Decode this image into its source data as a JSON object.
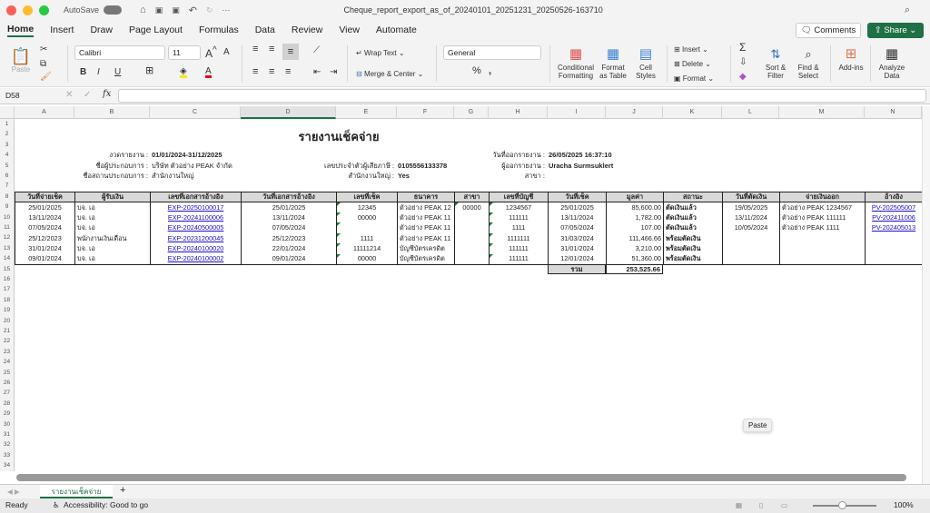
{
  "window": {
    "autosave": "AutoSave",
    "title": "Cheque_report_export_as_of_20240101_20251231_20250526-163710"
  },
  "menu": [
    "Home",
    "Insert",
    "Draw",
    "Page Layout",
    "Formulas",
    "Data",
    "Review",
    "View",
    "Automate"
  ],
  "ribbon": {
    "paste": "Paste",
    "font": "Calibri",
    "size": "11",
    "wrap": "Wrap Text",
    "merge": "Merge & Center",
    "number_format": "General",
    "percent": "%",
    "comma": ",",
    "cond": "Conditional Formatting",
    "fmt_table": "Format as Table",
    "cell_styles": "Cell Styles",
    "insert": "Insert",
    "delete": "Delete",
    "format": "Format",
    "sort": "Sort & Filter",
    "find": "Find & Select",
    "addins": "Add-ins",
    "analyze": "Analyze Data",
    "comments": "Comments",
    "share": "Share",
    "bold": "B",
    "italic": "I",
    "underline": "U",
    "fx": "fx"
  },
  "formula": {
    "cell_ref": "D58",
    "value": ""
  },
  "columns": [
    "A",
    "B",
    "C",
    "D",
    "E",
    "F",
    "G",
    "H",
    "I",
    "J",
    "K",
    "L",
    "M",
    "N"
  ],
  "report": {
    "title": "รายงานเช็คจ่าย",
    "info_left": [
      {
        "label": "งวดรายงาน :",
        "value": "01/01/2024-31/12/2025"
      },
      {
        "label": "ชื่อผู้ประกอบการ :",
        "value": "บริษัท ตัวอย่าง PEAK จำกัด"
      },
      {
        "label": "ชื่อสถานประกอบการ :",
        "value": "สำนักงานใหญ่"
      }
    ],
    "info_mid": [
      {
        "label": "เลขประจำตัวผู้เสียภาษี :",
        "value": "0105556133378"
      },
      {
        "label": "สำนักงานใหญ่ :",
        "value": "Yes"
      }
    ],
    "info_right": [
      {
        "label": "วันที่ออกรายงาน :",
        "value": "26/05/2025 16:37:10"
      },
      {
        "label": "ผู้ออกรายงาน :",
        "value": "Uracha Surmsuklert"
      },
      {
        "label": "สาขา :",
        "value": ""
      }
    ],
    "headers": [
      "วันที่จ่ายเช็ค",
      "ผู้รับเงิน",
      "เลขที่เอกสารอ้างอิง",
      "วันที่เอกสารอ้างอิง",
      "เลขที่เช็ค",
      "ธนาคาร",
      "สาขา",
      "เลขที่บัญชี",
      "วันที่เช็ค",
      "มูลค่า",
      "สถานะ",
      "วันที่ตัดเงิน",
      "จ่ายเงินออก",
      "อ้างอิง"
    ],
    "rows": [
      [
        "25/01/2025",
        "บจ. เอ",
        "EXP-20250100017",
        "25/01/2025",
        "12345",
        "ตัวอย่าง PEAK 12",
        "00000",
        "1234567",
        "25/01/2025",
        "85,600.00",
        "ตัดเงินแล้ว",
        "19/05/2025",
        "ตัวอย่าง PEAK 1234567",
        "PV-202505007"
      ],
      [
        "13/11/2024",
        "บจ. เอ",
        "EXP-20241100006",
        "13/11/2024",
        "00000",
        "ตัวอย่าง PEAK 11",
        "",
        "111111",
        "13/11/2024",
        "1,782.00",
        "ตัดเงินแล้ว",
        "13/11/2024",
        "ตัวอย่าง PEAK 111111",
        "PV-202411006"
      ],
      [
        "07/05/2024",
        "บจ. เอ",
        "EXP-20240500005",
        "07/05/2024",
        "",
        "ตัวอย่าง PEAK 11",
        "",
        "1111",
        "07/05/2024",
        "107.00",
        "ตัดเงินแล้ว",
        "10/05/2024",
        "ตัวอย่าง PEAK 1111",
        "PV-202405013"
      ],
      [
        "25/12/2023",
        "พนักงานเงินเดือน",
        "EXP-20231200045",
        "25/12/2023",
        "1111",
        "ตัวอย่าง PEAK 11",
        "",
        "1111111",
        "31/03/2024",
        "111,466.66",
        "พร้อมตัดเงิน",
        "",
        "",
        ""
      ],
      [
        "31/01/2024",
        "บจ. เอ",
        "EXP-20240100020",
        "22/01/2024",
        "11111214",
        "บัญชีบัตรเครดิต",
        "",
        "111111",
        "31/01/2024",
        "3,210.00",
        "พร้อมตัดเงิน",
        "",
        "",
        ""
      ],
      [
        "09/01/2024",
        "บจ. เอ",
        "EXP-20240100002",
        "09/01/2024",
        "00000",
        "บัญชีบัตรเครดิต",
        "",
        "111111",
        "12/01/2024",
        "51,360.00",
        "พร้อมตัดเงิน",
        "",
        "",
        ""
      ]
    ],
    "total_label": "รวม",
    "total_value": "253,525.66"
  },
  "tooltip": "Paste",
  "sheet_tab": "รายงานเช็คจ่าย",
  "add_sheet": "+",
  "status": {
    "ready": "Ready",
    "accessibility": "Accessibility: Good to go",
    "zoom": "100%"
  },
  "colors": {
    "accent": "#1e7145",
    "link": "#1a0dcc",
    "header_fill": "#d9d9d9"
  }
}
